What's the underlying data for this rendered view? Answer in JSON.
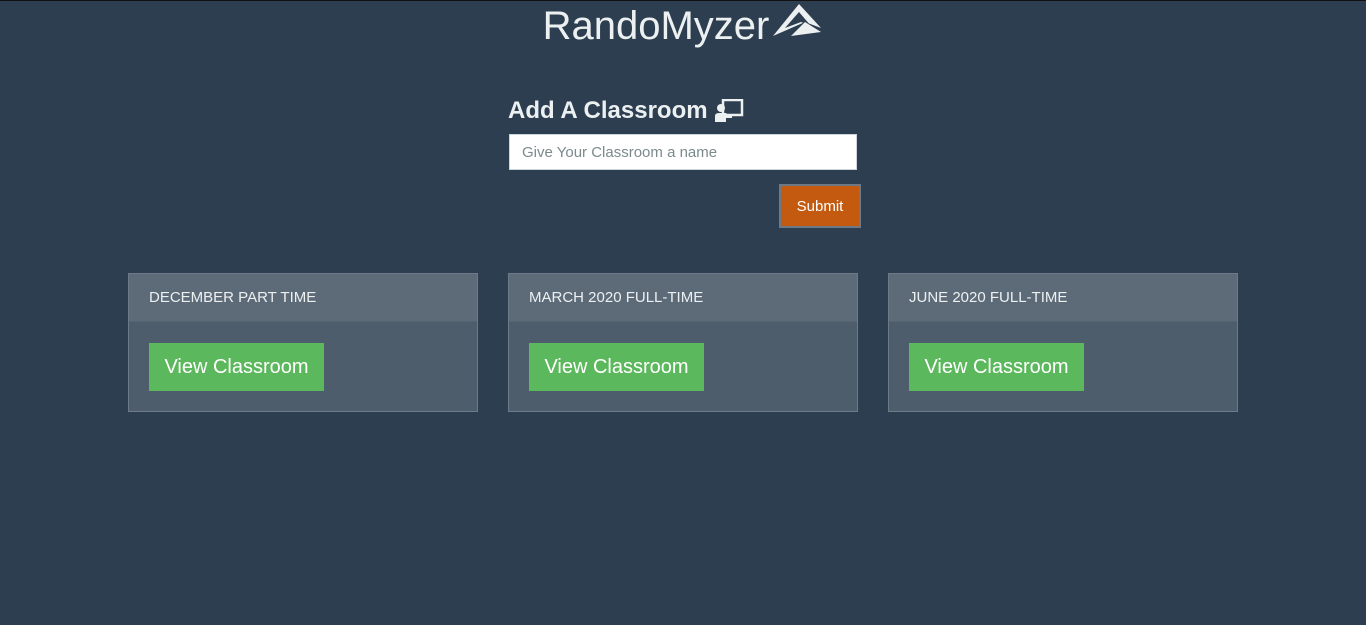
{
  "brand": {
    "name": "RandoMyzer",
    "logo_icon": "paper-plane-logo"
  },
  "add_form": {
    "title": "Add A Classroom",
    "title_icon": "chalkboard-teacher-icon",
    "input_placeholder": "Give Your Classroom a name",
    "input_value": "",
    "submit_label": "Submit"
  },
  "classrooms": [
    {
      "name": "DECEMBER PART TIME",
      "button_label": "View Classroom"
    },
    {
      "name": "MARCH 2020 FULL-TIME",
      "button_label": "View Classroom"
    },
    {
      "name": "JUNE 2020 FULL-TIME",
      "button_label": "View Classroom"
    }
  ],
  "colors": {
    "background": "#2c3e50",
    "submit": "#c35a10",
    "view_button": "#5cb85c",
    "card": "#4e5d6c",
    "card_header": "#5d6b79"
  }
}
